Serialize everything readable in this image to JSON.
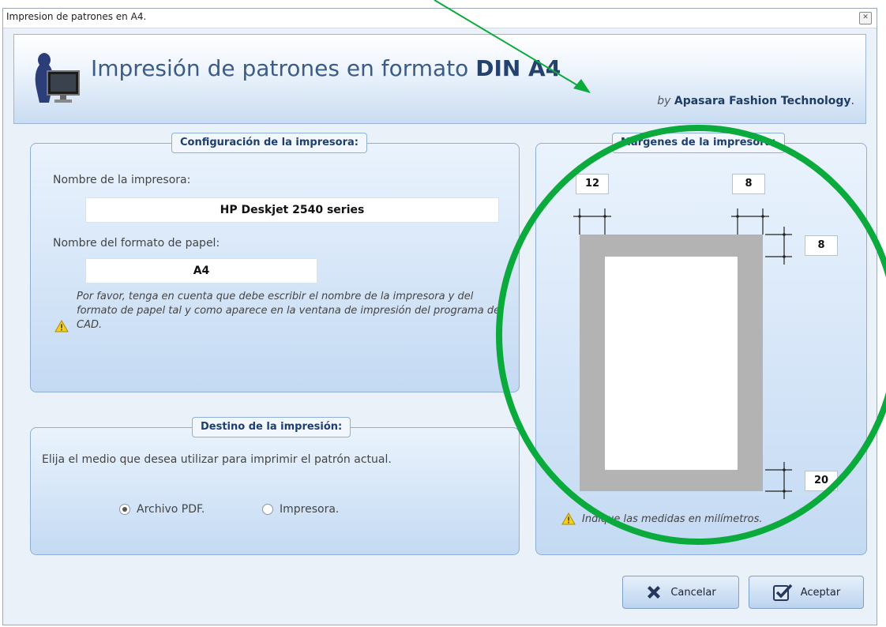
{
  "window": {
    "title": "Impresion de patrones en A4.",
    "close_label": "✕"
  },
  "header": {
    "title_main": "Impresión de patrones en formato ",
    "title_bold": "DIN A4",
    "by_prefix": "by ",
    "by_company": "Apasara Fashion Technology",
    "by_suffix": "."
  },
  "printer_config": {
    "legend": "Configuración de la impresora:",
    "printer_name_label": "Nombre de la impresora:",
    "printer_name_value": "HP Deskjet 2540 series",
    "paper_format_label": "Nombre del formato de papel:",
    "paper_format_value": "A4",
    "warning_text": "Por favor, tenga en cuenta que debe escribir el nombre de la impresora y del formato de papel tal y como aparece en la ventana de impresión del programa de CAD."
  },
  "destination": {
    "legend": "Destino de la impresión:",
    "instruction": "Elija el medio que desea utilizar para imprimir el patrón actual.",
    "options": [
      {
        "label": "Archivo PDF.",
        "selected": true
      },
      {
        "label": "Impresora.",
        "selected": false
      }
    ]
  },
  "margins": {
    "legend": "Margenes de la impresora:",
    "left": "12",
    "right": "8",
    "top": "8",
    "bottom": "20",
    "note": "Indique las medidas en milímetros."
  },
  "buttons": {
    "cancel": "Cancelar",
    "accept": "Aceptar"
  },
  "colors": {
    "annotation_green": "#0aaa3c",
    "accent_blue": "#1e3f6e",
    "margin_gray": "#b3b3b3"
  },
  "icons": [
    "dress-form-monitor-icon",
    "warning-icon",
    "cancel-x-icon",
    "accept-check-icon"
  ]
}
